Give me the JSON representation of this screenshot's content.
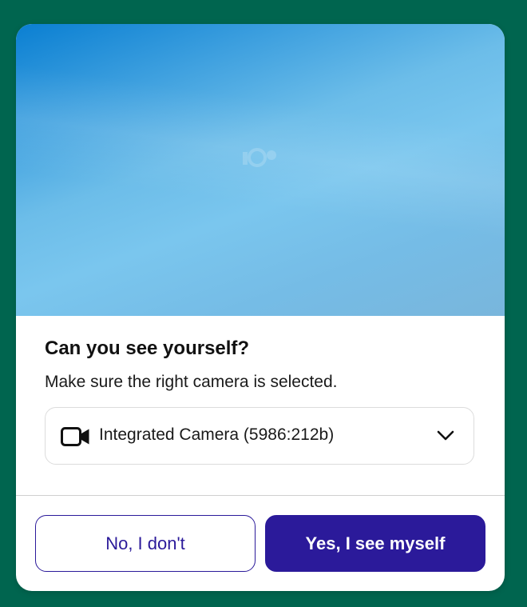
{
  "modal": {
    "title": "Can you see yourself?",
    "subtitle": "Make sure the right camera is selected.",
    "camera_select": {
      "selected": "Integrated Camera (5986:212b)",
      "icon": "video-camera-icon",
      "dropdown_icon": "chevron-down-icon"
    },
    "buttons": {
      "no_label": "No, I don't",
      "yes_label": "Yes, I see myself"
    }
  },
  "colors": {
    "page_background": "#00654f",
    "primary": "#2b1a9a",
    "preview_top": "#0a7fd2",
    "preview_mid": "#7ac6ee"
  }
}
